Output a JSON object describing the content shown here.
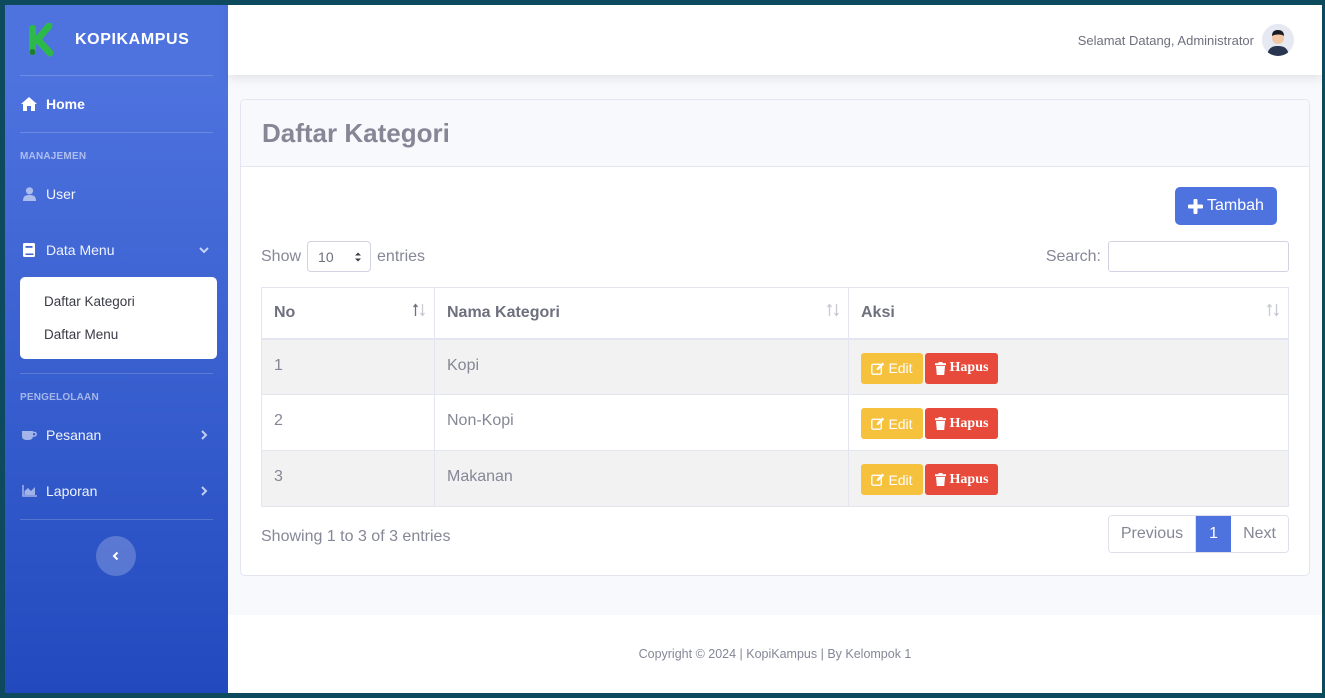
{
  "brand": {
    "name": "KOPIKAMPUS",
    "logo_color": "#2db84a"
  },
  "sidebar": {
    "home": "Home",
    "heading_manajemen": "MANAJEMEN",
    "user": "User",
    "data_menu": "Data Menu",
    "submenu": [
      "Daftar Kategori",
      "Daftar Menu"
    ],
    "heading_pengelolaan": "PENGELOLAAN",
    "pesanan": "Pesanan",
    "laporan": "Laporan"
  },
  "topbar": {
    "welcome": "Selamat Datang, Administrator"
  },
  "page": {
    "title": "Daftar Kategori",
    "add_button": "Tambah",
    "show_label": "Show",
    "entries_label": "entries",
    "page_length": "10",
    "search_label": "Search:"
  },
  "table": {
    "headers": [
      "No",
      "Nama Kategori",
      "Aksi"
    ],
    "rows": [
      {
        "no": "1",
        "nama": "Kopi"
      },
      {
        "no": "2",
        "nama": "Non-Kopi"
      },
      {
        "no": "3",
        "nama": "Makanan"
      }
    ],
    "edit_label": "Edit",
    "hapus_label": "Hapus"
  },
  "info": "Showing 1 to 3 of 3 entries",
  "pagination": {
    "previous": "Previous",
    "current": "1",
    "next": "Next"
  },
  "footer": "Copyright © 2024 | KopiKampus | By Kelompok 1",
  "colors": {
    "primary": "#4e73df",
    "warning": "#f6c23e",
    "danger": "#e74a3b"
  }
}
